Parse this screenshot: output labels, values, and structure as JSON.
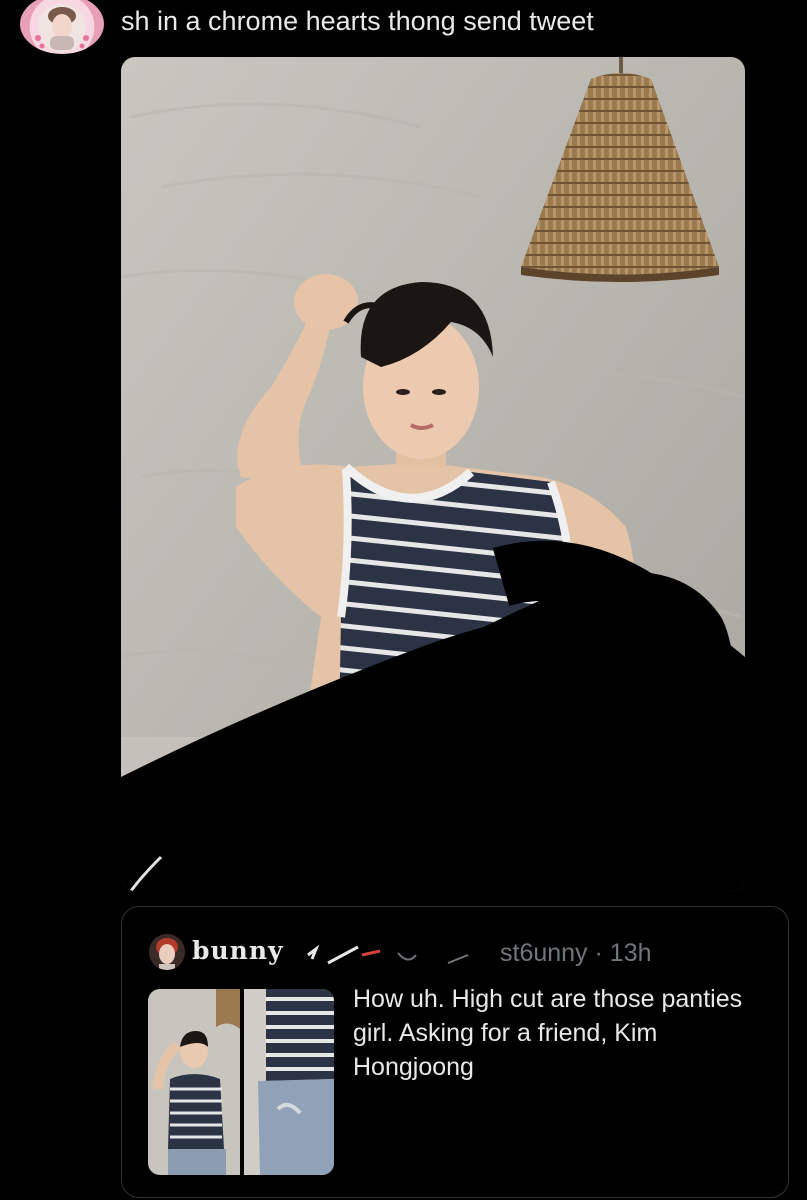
{
  "tweet": {
    "text": "sh in a chrome hearts thong send tweet",
    "avatar_icon": "user-avatar"
  },
  "media": {
    "kind": "photo",
    "icon": "photo-person-striped-tank"
  },
  "quoted_tweet": {
    "display_name": "bunny",
    "handle_fragment": "st6unny",
    "separator": "·",
    "time_ago": "13h",
    "text": "How uh. High cut are those panties girl. Asking for a friend, Kim Hongjoong"
  },
  "colors": {
    "background": "#000000",
    "text_primary": "#e7e9ea",
    "text_secondary": "#71767b",
    "border": "#2f3336"
  }
}
